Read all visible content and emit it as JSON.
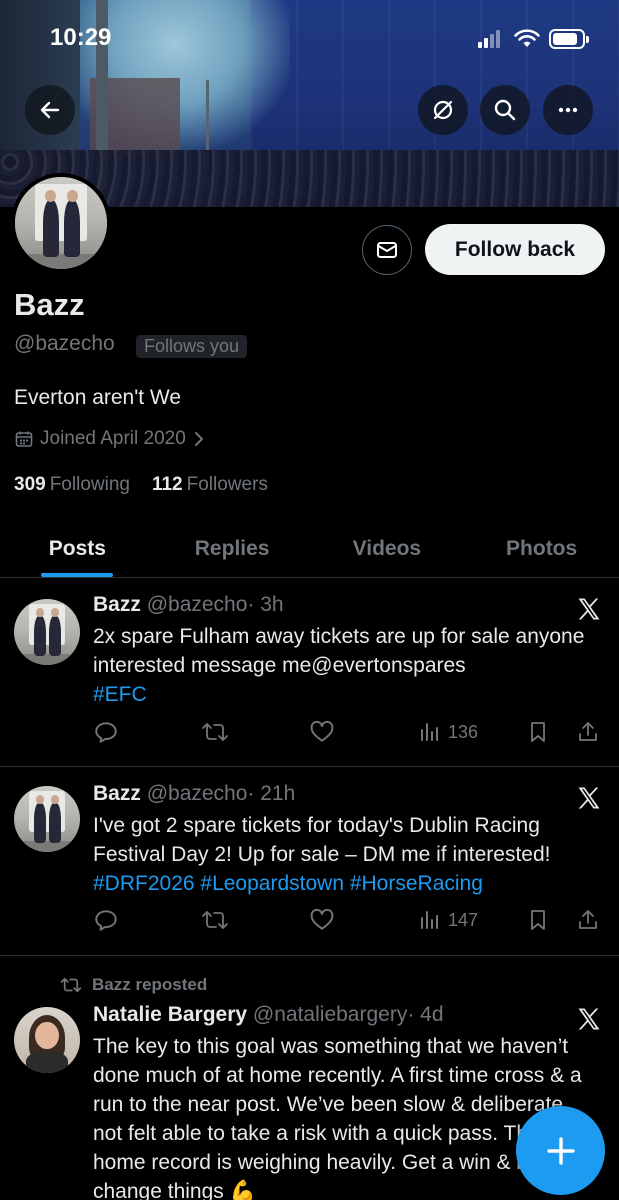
{
  "status_bar": {
    "time": "10:29"
  },
  "profile": {
    "display_name": "Bazz",
    "handle": "@bazecho",
    "follows_you_badge": "Follows you",
    "bio": "Everton aren't We",
    "joined": "Joined April 2020",
    "following_count": "309",
    "following_label": "Following",
    "followers_count": "112",
    "followers_label": "Followers",
    "follow_button_label": "Follow back"
  },
  "tabs": [
    {
      "label": "Posts",
      "active": true
    },
    {
      "label": "Replies",
      "active": false
    },
    {
      "label": "Videos",
      "active": false
    },
    {
      "label": "Photos",
      "active": false
    }
  ],
  "posts": [
    {
      "author": "Bazz",
      "handle": "@bazecho",
      "time": "· 3h",
      "text_plain": "2x spare Fulham away tickets are up for sale anyone interested message me@evertonspares",
      "hashtags": "#EFC",
      "views": "136"
    },
    {
      "author": "Bazz",
      "handle": "@bazecho",
      "time": "· 21h",
      "text_plain": "I've got 2 spare tickets for today's Dublin Racing Festival Day 2! Up for sale – DM me if interested!",
      "hashtags": "#DRF2026 #Leopardstown #HorseRacing",
      "views": "147"
    },
    {
      "repost_label": "Bazz reposted",
      "author": "Natalie Bargery",
      "handle": "@nataliebargery",
      "time": "· 4d",
      "text_plain": "The key to this goal was something that we haven’t done much of at home recently. A first time cross & a run to the near post. We’ve been slow & deliberate, not felt able to take a risk with a quick pass. The home record is weighing heavily. Get a win & it will change things 💪"
    }
  ],
  "icons": {
    "back": "back-arrow-icon",
    "grok": "grok-icon",
    "search": "search-icon",
    "more": "more-icon",
    "message": "envelope-icon",
    "calendar": "calendar-icon",
    "x_logo": "x-logo-icon",
    "compose": "plus-icon"
  },
  "colors": {
    "accent": "#1d9bf0",
    "background": "#000000",
    "secondary_text": "#71767b"
  }
}
